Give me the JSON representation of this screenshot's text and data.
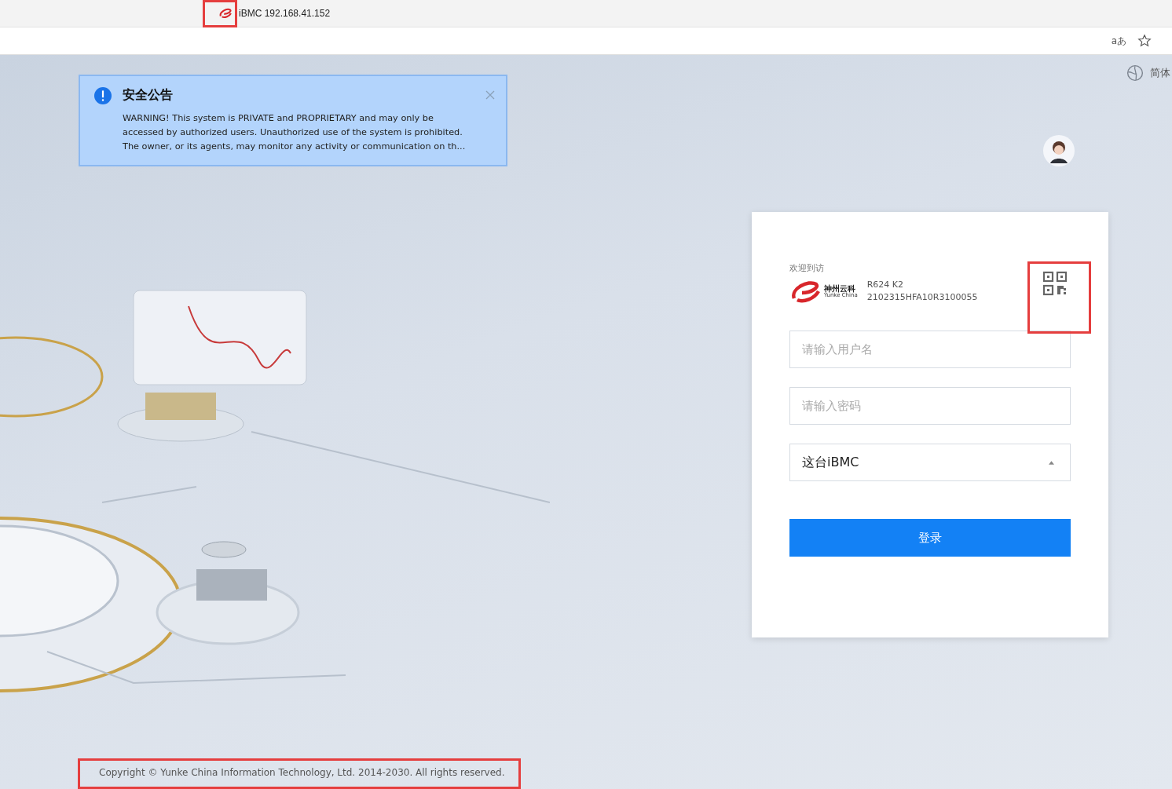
{
  "browser": {
    "tab_title": "iBMC 192.168.41.152",
    "reader_label": "aあ"
  },
  "language": {
    "label": "简体"
  },
  "notice": {
    "title": "安全公告",
    "message": "WARNING! This system is PRIVATE and PROPRIETARY and may only be accessed by authorized users. Unauthorized use of the system is prohibited. The owner, or its agents, may monitor any activity or communication on th..."
  },
  "login": {
    "welcome": "欢迎到访",
    "brand_cn": "神州云科",
    "brand_en": "Yunke China",
    "model": "R624 K2",
    "serial": "2102315HFA10R3100055",
    "username": {
      "placeholder": "请输入用户名"
    },
    "password": {
      "placeholder": "请输入密码"
    },
    "domain": {
      "value": "这台iBMC"
    },
    "submit": "登录"
  },
  "footer": {
    "copyright": "Copyright © Yunke China Information Technology, Ltd. 2014-2030. All rights reserved."
  }
}
